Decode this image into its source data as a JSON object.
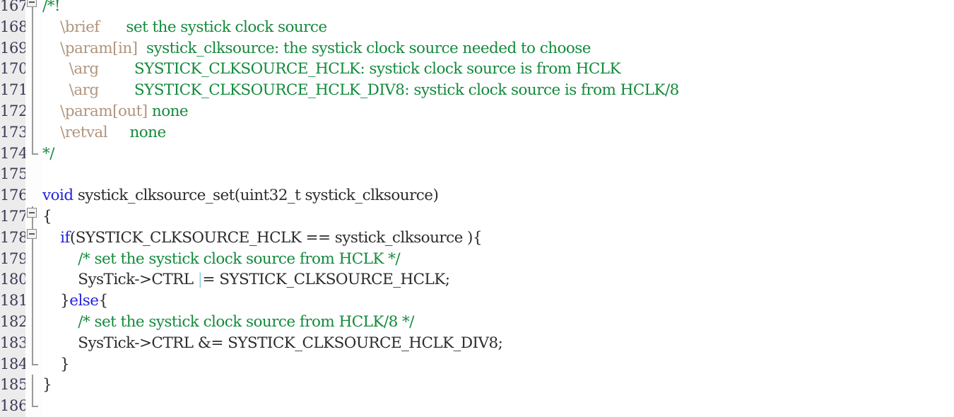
{
  "editor": {
    "type": "code-editor",
    "language": "c",
    "first_line": 167,
    "last_line": 186,
    "current_line": 186,
    "colors": {
      "gutter_bg": "#ececec",
      "gutter_fg": "#3a3a56",
      "code_bg": "#ffffff",
      "code_fg": "#2c2c2c",
      "keyword": "#2222dd",
      "comment": "#138a3c",
      "doxygen_tag": "#b1957c",
      "current_line_bg": "#ddf7e1",
      "cursor": "#8fd3e8",
      "fold_marker": "#9a9a9a"
    }
  },
  "line_numbers": [
    "167",
    "168",
    "169",
    "170",
    "171",
    "172",
    "173",
    "174",
    "175",
    "176",
    "177",
    "178",
    "179",
    "180",
    "181",
    "182",
    "183",
    "184",
    "185",
    "186"
  ],
  "fold_markers": [
    {
      "line": "167",
      "type": "box-minus"
    },
    {
      "line": "168",
      "type": "line"
    },
    {
      "line": "169",
      "type": "line"
    },
    {
      "line": "170",
      "type": "line"
    },
    {
      "line": "171",
      "type": "line"
    },
    {
      "line": "172",
      "type": "line"
    },
    {
      "line": "173",
      "type": "line"
    },
    {
      "line": "174",
      "type": "end"
    },
    {
      "line": "175",
      "type": "none"
    },
    {
      "line": "176",
      "type": "none"
    },
    {
      "line": "177",
      "type": "box-minus"
    },
    {
      "line": "178",
      "type": "box-minus"
    },
    {
      "line": "179",
      "type": "line"
    },
    {
      "line": "180",
      "type": "line"
    },
    {
      "line": "181",
      "type": "line"
    },
    {
      "line": "182",
      "type": "line"
    },
    {
      "line": "183",
      "type": "line"
    },
    {
      "line": "184",
      "type": "end"
    },
    {
      "line": "185",
      "type": "line"
    },
    {
      "line": "186",
      "type": "end"
    }
  ],
  "code_lines": [
    {
      "number": "167",
      "text": "/*!",
      "tokens": [
        {
          "t": "/*!",
          "c": "cmt"
        }
      ]
    },
    {
      "number": "168",
      "text": "    \\brief      set the systick clock source",
      "tokens": [
        {
          "t": "    ",
          "c": "plain"
        },
        {
          "t": "\\brief",
          "c": "dox"
        },
        {
          "t": "      ",
          "c": "plain"
        },
        {
          "t": "set the systick clock source",
          "c": "cmt"
        }
      ]
    },
    {
      "number": "169",
      "text": "    \\param[in]  systick_clksource: the systick clock source needed to choose",
      "tokens": [
        {
          "t": "    ",
          "c": "plain"
        },
        {
          "t": "\\param[in]",
          "c": "dox"
        },
        {
          "t": "  ",
          "c": "plain"
        },
        {
          "t": "systick_clksource: the systick clock source needed to choose",
          "c": "cmt"
        }
      ]
    },
    {
      "number": "170",
      "text": "      \\arg        SYSTICK_CLKSOURCE_HCLK: systick clock source is from HCLK",
      "tokens": [
        {
          "t": "      ",
          "c": "plain"
        },
        {
          "t": "\\arg",
          "c": "dox"
        },
        {
          "t": "        ",
          "c": "plain"
        },
        {
          "t": "SYSTICK_CLKSOURCE_HCLK: systick clock source is from HCLK",
          "c": "cmt"
        }
      ]
    },
    {
      "number": "171",
      "text": "      \\arg        SYSTICK_CLKSOURCE_HCLK_DIV8: systick clock source is from HCLK/8",
      "tokens": [
        {
          "t": "      ",
          "c": "plain"
        },
        {
          "t": "\\arg",
          "c": "dox"
        },
        {
          "t": "        ",
          "c": "plain"
        },
        {
          "t": "SYSTICK_CLKSOURCE_HCLK_DIV8: systick clock source is from HCLK/8",
          "c": "cmt"
        }
      ]
    },
    {
      "number": "172",
      "text": "    \\param[out] none",
      "tokens": [
        {
          "t": "    ",
          "c": "plain"
        },
        {
          "t": "\\param[out]",
          "c": "dox"
        },
        {
          "t": " ",
          "c": "plain"
        },
        {
          "t": "none",
          "c": "cmt"
        }
      ]
    },
    {
      "number": "173",
      "text": "    \\retval     none",
      "tokens": [
        {
          "t": "    ",
          "c": "plain"
        },
        {
          "t": "\\retval",
          "c": "dox"
        },
        {
          "t": "     ",
          "c": "plain"
        },
        {
          "t": "none",
          "c": "cmt"
        }
      ]
    },
    {
      "number": "174",
      "text": "*/",
      "tokens": [
        {
          "t": "*/",
          "c": "cmt"
        }
      ]
    },
    {
      "number": "175",
      "text": "",
      "tokens": []
    },
    {
      "number": "176",
      "text": "void systick_clksource_set(uint32_t systick_clksource)",
      "tokens": [
        {
          "t": "void",
          "c": "kw"
        },
        {
          "t": " systick_clksource_set(uint32_t systick_clksource)",
          "c": "ident"
        }
      ]
    },
    {
      "number": "177",
      "text": "{",
      "tokens": [
        {
          "t": "{",
          "c": "punct"
        }
      ]
    },
    {
      "number": "178",
      "text": "    if(SYSTICK_CLKSOURCE_HCLK == systick_clksource ){",
      "tokens": [
        {
          "t": "    ",
          "c": "plain"
        },
        {
          "t": "if",
          "c": "kw"
        },
        {
          "t": "(SYSTICK_CLKSOURCE_HCLK == systick_clksource ){",
          "c": "ident"
        }
      ]
    },
    {
      "number": "179",
      "text": "        /* set the systick clock source from HCLK */",
      "tokens": [
        {
          "t": "        ",
          "c": "plain"
        },
        {
          "t": "/* set the systick clock source from HCLK */",
          "c": "cmt"
        }
      ]
    },
    {
      "number": "180",
      "text": "        SysTick->CTRL |= SYSTICK_CLKSOURCE_HCLK;",
      "has_cursor": true,
      "tokens": [
        {
          "t": "        ",
          "c": "plain"
        },
        {
          "t": "SysTick->CTRL ",
          "c": "ident"
        },
        {
          "t": "|",
          "c": "caret"
        },
        {
          "t": "= SYSTICK_CLKSOURCE_HCLK;",
          "c": "ident"
        }
      ]
    },
    {
      "number": "181",
      "text": "    }else{",
      "tokens": [
        {
          "t": "    ",
          "c": "plain"
        },
        {
          "t": "}",
          "c": "punct"
        },
        {
          "t": "else",
          "c": "kw"
        },
        {
          "t": "{",
          "c": "punct"
        }
      ]
    },
    {
      "number": "182",
      "text": "        /* set the systick clock source from HCLK/8 */",
      "tokens": [
        {
          "t": "        ",
          "c": "plain"
        },
        {
          "t": "/* set the systick clock source from HCLK/8 */",
          "c": "cmt"
        }
      ]
    },
    {
      "number": "183",
      "text": "        SysTick->CTRL &= SYSTICK_CLKSOURCE_HCLK_DIV8;",
      "tokens": [
        {
          "t": "        ",
          "c": "plain"
        },
        {
          "t": "SysTick->CTRL &= SYSTICK_CLKSOURCE_HCLK_DIV8;",
          "c": "ident"
        }
      ]
    },
    {
      "number": "184",
      "text": "    }",
      "tokens": [
        {
          "t": "    ",
          "c": "plain"
        },
        {
          "t": "}",
          "c": "punct"
        }
      ]
    },
    {
      "number": "185",
      "text": "}",
      "tokens": [
        {
          "t": "}",
          "c": "punct"
        }
      ]
    },
    {
      "number": "186",
      "text": "",
      "is_current": true,
      "tokens": []
    }
  ]
}
